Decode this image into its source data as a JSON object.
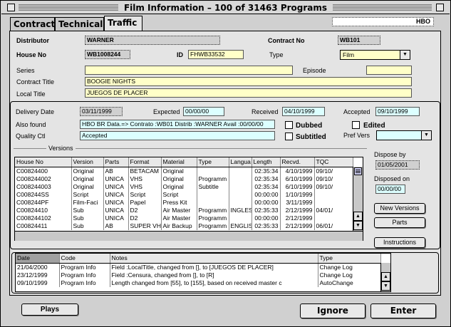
{
  "window": {
    "title": "Film Information – 100 of 31463 Programs"
  },
  "tabs": [
    {
      "label": "Contract"
    },
    {
      "label": "Technical"
    },
    {
      "label": "Traffic"
    }
  ],
  "header": {
    "channel": "HBO",
    "distributor_label": "Distributor",
    "distributor": "WARNER",
    "contract_no_label": "Contract No",
    "contract_no": "WB101",
    "house_no_label": "House No",
    "house_no": "WB1008244",
    "id_label": "ID",
    "id": "FHWB33532",
    "type_label": "Type",
    "type": "Film",
    "series_label": "Series",
    "series": "",
    "episode_label": "Episode",
    "episode": "",
    "contract_title_label": "Contract Title",
    "contract_title": "BOOGIE NIGHTS",
    "local_title_label": "Local Title",
    "local_title": "JUEGOS DE PLACER"
  },
  "delivery": {
    "delivery_date_label": "Delivery Date",
    "delivery_date": "03/11/1999",
    "expected_label": "Expected",
    "expected": "00/00/00",
    "received_label": "Received",
    "received": "04/10/1999",
    "accepted_label": "Accepted",
    "accepted": "09/10/1999",
    "also_found_label": "Also found",
    "also_found": "HBO BR Data.=> Contrato :WB01 Distrib :WARNER Avail :00/00/00",
    "quality_ctl_label": "Quality Ctl",
    "quality_ctl": "Accepted",
    "dubbed_label": "Dubbed",
    "edited_label": "Edited",
    "subtitled_label": "Subtitled",
    "pref_vers_label": "Pref Vers",
    "pref_vers": ""
  },
  "versions": {
    "section_label": "Versions",
    "columns": [
      "House No",
      "Version",
      "Parts",
      "Format",
      "Material",
      "Type",
      "Langua",
      "Length",
      "Recvd.",
      "TQC"
    ],
    "rows": [
      [
        "C00824400",
        "Original",
        "AB",
        "BETACAM",
        "Original",
        "",
        "",
        "02:35:34",
        "4/10/1999",
        "09/10/"
      ],
      [
        "C008244002",
        "Original",
        "UNICA",
        "VHS",
        "Original",
        "Programm",
        "",
        "02:35:34",
        "6/10/1999",
        "09/10/"
      ],
      [
        "C008244003",
        "Original",
        "UNICA",
        "VHS",
        "Original",
        "Subtitle",
        "",
        "02:35:34",
        "6/10/1999",
        "09/10/"
      ],
      [
        "C008244SS",
        "Script",
        "UNICA",
        "Script",
        "Script",
        "",
        "",
        "00:00:00",
        "1/10/1999",
        ""
      ],
      [
        "C008244PF",
        "Film-Faci",
        "UNICA",
        "Papel",
        "Press Kit",
        "",
        "",
        "00:00:00",
        "3/11/1999",
        ""
      ],
      [
        "C00824410",
        "Sub",
        "UNICA",
        "D2",
        "Air Master",
        "Programm",
        "INGLES",
        "02:35:33",
        "2/12/1999",
        "04/01/"
      ],
      [
        "C008244102",
        "Sub",
        "UNICA",
        "D2",
        "Air Master",
        "Programm",
        "",
        "00:00:00",
        "2/12/1999",
        ""
      ],
      [
        "C00824411",
        "Sub",
        "AB",
        "SUPER VH",
        "Air Backup",
        "Programm",
        "ENGLIS",
        "02:35:33",
        "2/12/1999",
        "06/01/"
      ]
    ]
  },
  "dispose": {
    "dispose_by_label": "Dispose by",
    "dispose_by": "01/05/2001",
    "disposed_on_label": "Disposed on",
    "disposed_on": "00/00/00",
    "new_versions_button": "New Versions",
    "parts_button": "Parts",
    "instructions_button": "Instructions"
  },
  "log": {
    "columns": [
      "Date",
      "Code",
      "Notes",
      "Type"
    ],
    "rows": [
      [
        "21/04/2000",
        "Program Info",
        "Field :LocalTitle, changed from [], to [JUEGOS DE PLACER]",
        "Change Log"
      ],
      [
        "23/12/1999",
        "Program Info",
        "Field :Censura, changed from [], to [R]",
        "Change Log"
      ],
      [
        "09/10/1999",
        "Program Info",
        "Length changed from [55], to [155], based on received master c",
        "AutoChange"
      ]
    ]
  },
  "footer": {
    "plays_button": "Plays",
    "ignore_button": "Ignore",
    "enter_button": "Enter"
  },
  "colors": {
    "field_yellow": "#ffffc8",
    "field_cyan": "#dcffff",
    "panel": "#e4e4e4",
    "window": "#d0d0d0"
  }
}
